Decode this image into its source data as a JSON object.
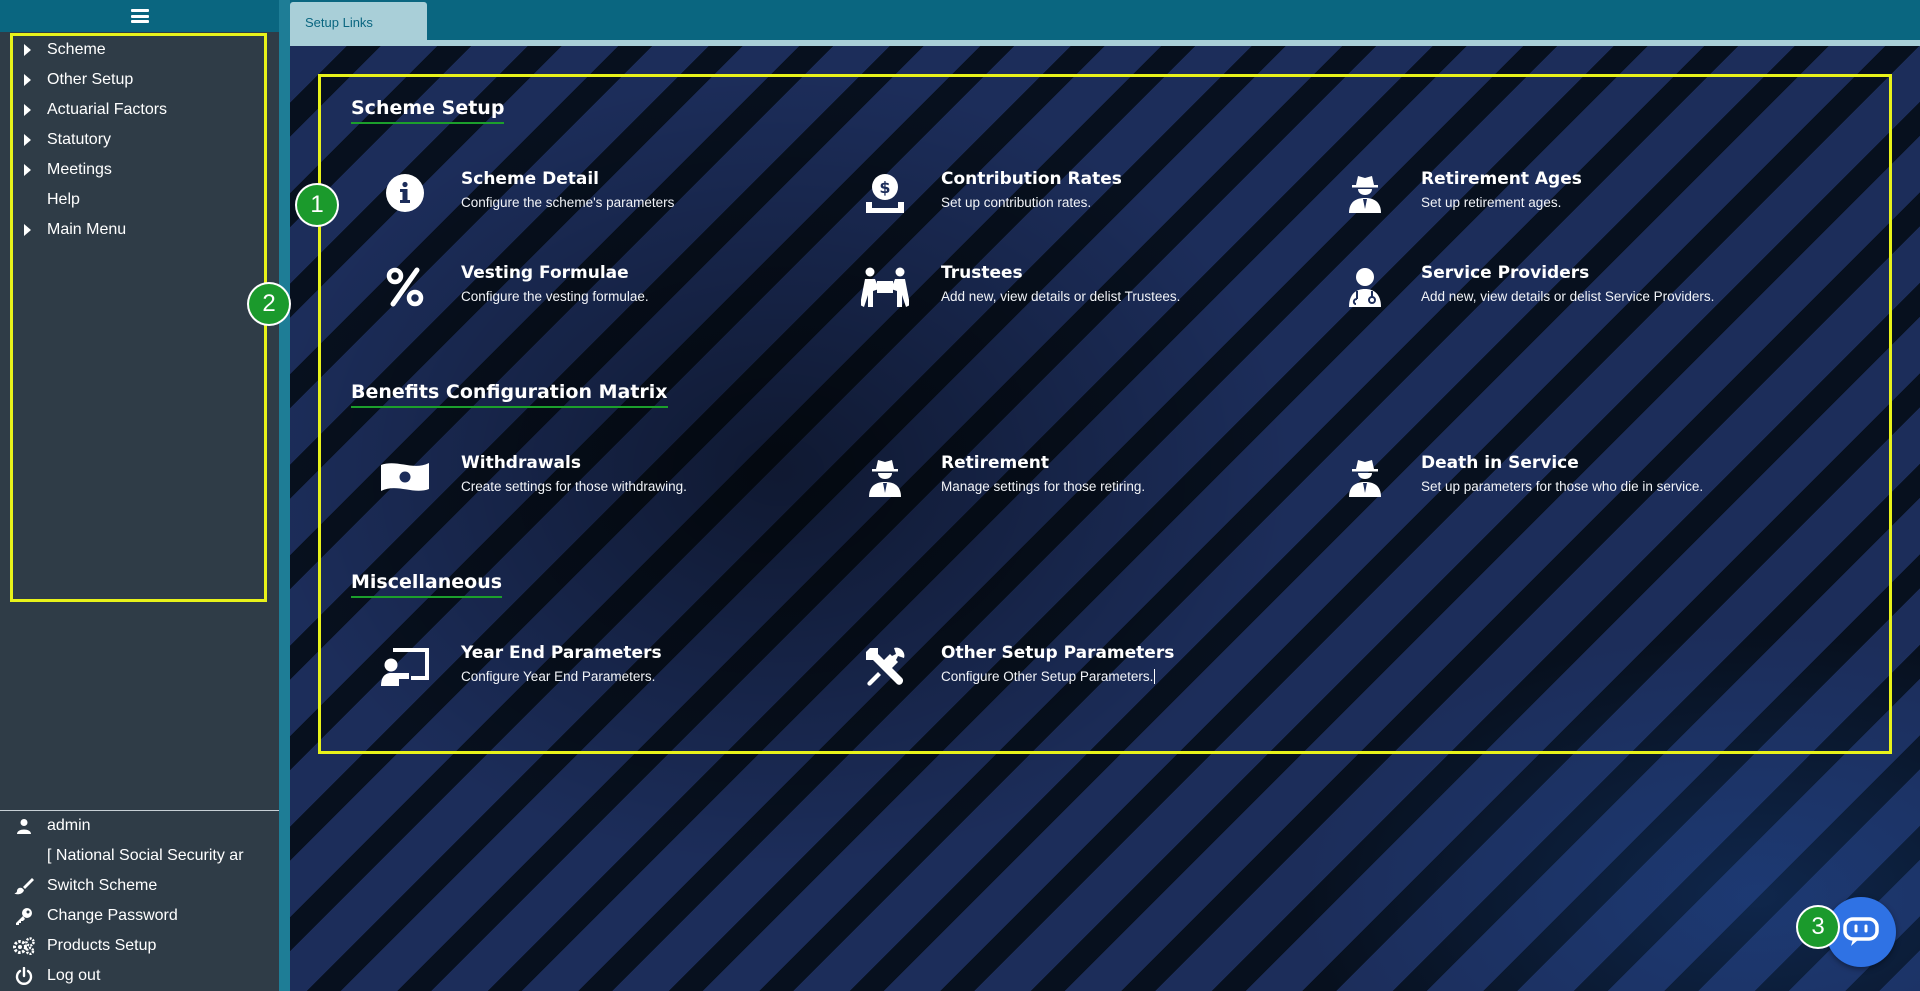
{
  "sidebar": {
    "menu": [
      {
        "label": "Scheme",
        "expandable": true
      },
      {
        "label": "Other Setup",
        "expandable": true
      },
      {
        "label": "Actuarial Factors",
        "expandable": true
      },
      {
        "label": "Statutory",
        "expandable": true
      },
      {
        "label": "Meetings",
        "expandable": true
      },
      {
        "label": "Help",
        "expandable": false
      },
      {
        "label": "Main Menu",
        "expandable": true
      }
    ],
    "user": {
      "username": "admin",
      "scheme_name": "[ National Social Security ar",
      "switch_scheme": "Switch Scheme",
      "change_password": "Change Password",
      "products_setup": "Products Setup",
      "logout": "Log out"
    }
  },
  "header": {
    "tab_label": "Setup Links"
  },
  "sections": {
    "scheme_setup": {
      "title": "Scheme Setup",
      "items": [
        {
          "title": "Scheme Detail",
          "desc": "Configure the scheme's parameters",
          "icon": "info-circle-icon"
        },
        {
          "title": "Contribution Rates",
          "desc": "Set up contribution rates.",
          "icon": "money-hand-icon"
        },
        {
          "title": "Retirement Ages",
          "desc": "Set up retirement ages.",
          "icon": "user-secret-icon"
        },
        {
          "title": "Vesting Formulae",
          "desc": "Configure the vesting formulae.",
          "icon": "percent-icon"
        },
        {
          "title": "Trustees",
          "desc": "Add new, view details or delist Trustees.",
          "icon": "people-carry-icon"
        },
        {
          "title": "Service Providers",
          "desc": "Add new, view details or delist Service Providers.",
          "icon": "user-doctor-icon"
        }
      ]
    },
    "benefits": {
      "title": "Benefits Configuration Matrix",
      "items": [
        {
          "title": "Withdrawals",
          "desc": "Create settings for those withdrawing.",
          "icon": "money-bill-wave-icon"
        },
        {
          "title": "Retirement",
          "desc": "Manage settings for those retiring.",
          "icon": "user-secret-icon"
        },
        {
          "title": "Death in Service",
          "desc": "Set up parameters for those who die in service.",
          "icon": "user-secret-icon"
        }
      ]
    },
    "misc": {
      "title": "Miscellaneous",
      "items": [
        {
          "title": "Year End Parameters",
          "desc": "Configure Year End Parameters.",
          "icon": "chalkboard-teacher-icon"
        },
        {
          "title": "Other Setup Parameters",
          "desc": "Configure Other Setup Parameters.",
          "icon": "tools-icon"
        }
      ]
    }
  },
  "annotations": {
    "badge1": "1",
    "badge2": "2",
    "badge3": "3"
  },
  "colors": {
    "header": "#0a6680",
    "highlight_border": "#e8f21a",
    "badge": "#1b9a2c",
    "chat_button": "#2f72e4",
    "title_underline": "#1c9f2c"
  }
}
